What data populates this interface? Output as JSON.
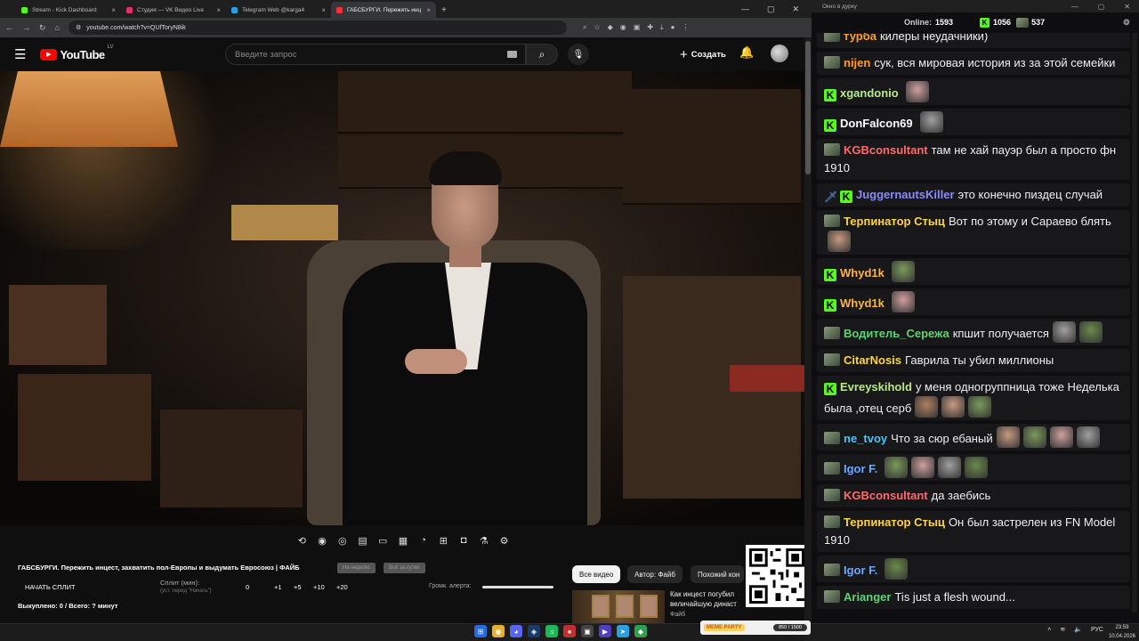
{
  "browser": {
    "tabs": [
      {
        "title": "Stream - Kick Dashboard",
        "color": "#53fc18",
        "active": false
      },
      {
        "title": "Студия — VK Видео Live",
        "color": "#e03070",
        "active": false
      },
      {
        "title": "Telegram Web @karga4",
        "color": "#2aa0e0",
        "active": false
      },
      {
        "title": "ГАБСБУРГИ. Пережить инц",
        "color": "#ff3030",
        "active": true
      }
    ],
    "url": "youtube.com/watch?v=QUfToryN8ik"
  },
  "youtube": {
    "logo": "YouTube",
    "logo_region": "LV",
    "search_placeholder": "Введите запрос",
    "create_label": "Создать"
  },
  "split_panel": {
    "video_title": "ГАБСБУРГИ. Пережить инцест, захватить пол-Европы и выдумать Евросоюз | ФАЙБ",
    "pill1": "На неделю",
    "pill2": "Всё за сутки",
    "start_split": "НАЧАТЬ СПЛИТ",
    "split_label": "Сплит (мин):",
    "split_note": "(уст. перед \"Начать\")",
    "split_buttons": [
      "0",
      "+1",
      "+5",
      "+10",
      "+20"
    ],
    "alert_volume_label": "Громк. алерта:",
    "alert_volume": 1.0,
    "bought": "Выкуплено: 0 / Всего: ? минут"
  },
  "chips": [
    "Все видео",
    "Автор: Файб",
    "Похожий кон"
  ],
  "rec": {
    "title": "Как инцест погубил величайшую династ",
    "channel": "Файб"
  },
  "meme": {
    "logo": "MEME PARTY",
    "value": "850 / 1500"
  },
  "taskbar": {
    "lang": "РУС",
    "time": "23:59",
    "date": "10.04.2026"
  },
  "chat": {
    "window_title": "Окно в дурку",
    "online_label": "Online:",
    "online": "1593",
    "kick_count": "1056",
    "other_count": "537",
    "messages": [
      {
        "badges": [
          "img"
        ],
        "nick": "турба",
        "color": "#ff9d2e",
        "text": "килеры неудачники)",
        "emotes": 0
      },
      {
        "badges": [
          "img"
        ],
        "nick": "nijen",
        "color": "#ff9d2e",
        "text": "сук, вся мировая история из за этой семейки",
        "emotes": 0
      },
      {
        "badges": [
          "kick"
        ],
        "nick": "xgandonio",
        "color": "#b8e986",
        "text": "",
        "emotes": 1
      },
      {
        "badges": [
          "kick"
        ],
        "nick": "DonFalcon69",
        "color": "#ffffff",
        "text": "",
        "emotes": 1
      },
      {
        "badges": [
          "img"
        ],
        "nick": "KGBconsultant",
        "color": "#ff6b6b",
        "text": "там не хай пауэр был а просто фн 1910",
        "emotes": 0
      },
      {
        "badges": [
          "sword",
          "kick"
        ],
        "nick": "JuggernautsKiller",
        "color": "#8a8aff",
        "text": "это конечно пиздец случай",
        "emotes": 0
      },
      {
        "badges": [
          "img"
        ],
        "nick": "Терпинатор Стыц",
        "color": "#ffd24a",
        "text": "Вот по этому и Сараево блять",
        "emotes": 1
      },
      {
        "badges": [
          "kick"
        ],
        "nick": "Whyd1k",
        "color": "#ffb347",
        "text": "",
        "emotes": 1
      },
      {
        "badges": [
          "kick"
        ],
        "nick": "Whyd1k",
        "color": "#ffb347",
        "text": "",
        "emotes": 1
      },
      {
        "badges": [
          "img"
        ],
        "nick": "Водитель_Сережа",
        "color": "#5fd36e",
        "text": "кпшит получается",
        "emotes": 2
      },
      {
        "badges": [
          "img"
        ],
        "nick": "CitarNosis",
        "color": "#ffd24a",
        "text": "Гаврила ты убил миллионы",
        "emotes": 0
      },
      {
        "badges": [
          "kick"
        ],
        "nick": "Evreyskihold",
        "color": "#b8e986",
        "text": "у меня одногруппница тоже Неделька была ,отец серб",
        "emotes": 3
      },
      {
        "badges": [
          "img"
        ],
        "nick": "ne_tvoy",
        "color": "#4fc3f7",
        "text": "Что за сюр ебаный",
        "emotes": 4
      },
      {
        "badges": [
          "img"
        ],
        "nick": "Igor F.",
        "color": "#6ea8ff",
        "text": "",
        "emotes": 4
      },
      {
        "badges": [
          "img"
        ],
        "nick": "KGBconsultant",
        "color": "#ff6b6b",
        "text": "да заебись",
        "emotes": 0
      },
      {
        "badges": [
          "img"
        ],
        "nick": "Терпинатор Стыц",
        "color": "#ffd24a",
        "text": "Он был застрелен из FN Model 1910",
        "emotes": 0
      },
      {
        "badges": [
          "img"
        ],
        "nick": "Igor F.",
        "color": "#6ea8ff",
        "text": "",
        "emotes": 1
      },
      {
        "badges": [
          "img"
        ],
        "nick": "Arianger",
        "color": "#5fd36e",
        "text": "Tis just a flesh wound...",
        "emotes": 0
      }
    ]
  }
}
